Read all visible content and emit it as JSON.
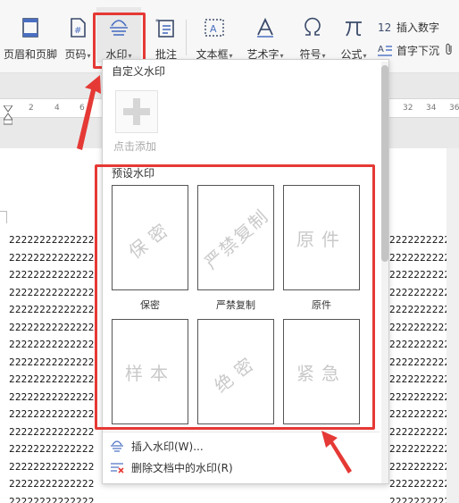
{
  "toolbar": {
    "items": [
      {
        "label": "页眉和页脚",
        "icon": "header-footer-icon"
      },
      {
        "label": "页码",
        "icon": "page-number-icon",
        "has_dropdown": true
      },
      {
        "label": "水印",
        "icon": "watermark-icon",
        "has_dropdown": true,
        "active": true
      },
      {
        "label": "批注",
        "icon": "comment-icon"
      },
      {
        "label": "文本框",
        "icon": "textbox-icon",
        "has_dropdown": true
      },
      {
        "label": "艺术字",
        "icon": "wordart-icon",
        "has_dropdown": true
      },
      {
        "label": "符号",
        "icon": "symbol-icon",
        "has_dropdown": true
      },
      {
        "label": "公式",
        "icon": "formula-icon",
        "has_dropdown": true
      }
    ],
    "small_items": [
      {
        "label": "插入数字",
        "icon": "insert-number-icon"
      },
      {
        "label": "首字下沉",
        "icon": "drop-cap-icon"
      }
    ],
    "dropdown_arrow": "▾"
  },
  "ruler": {
    "left_ticks": [
      "2",
      "4",
      "6"
    ],
    "right_ticks": [
      "32",
      "34",
      "36"
    ]
  },
  "watermark_menu": {
    "custom_section_title": "自定义水印",
    "add_label": "点击添加",
    "preset_section_title": "预设水印",
    "presets": [
      {
        "text": "保密",
        "caption": "保密"
      },
      {
        "text": "严禁复制",
        "caption": "严禁复制"
      },
      {
        "text": "原件",
        "caption": "原件"
      },
      {
        "text": "样本",
        "caption": ""
      },
      {
        "text": "绝密",
        "caption": ""
      },
      {
        "text": "紧急",
        "caption": ""
      }
    ],
    "insert_label": "插入水印(W)...",
    "delete_label": "删除文档中的水印(R)"
  },
  "document": {
    "line_text": "22222222222222",
    "line_text_right": "22222222222"
  },
  "colors": {
    "highlight": "#e53935",
    "accent": "#4a6fc2"
  }
}
